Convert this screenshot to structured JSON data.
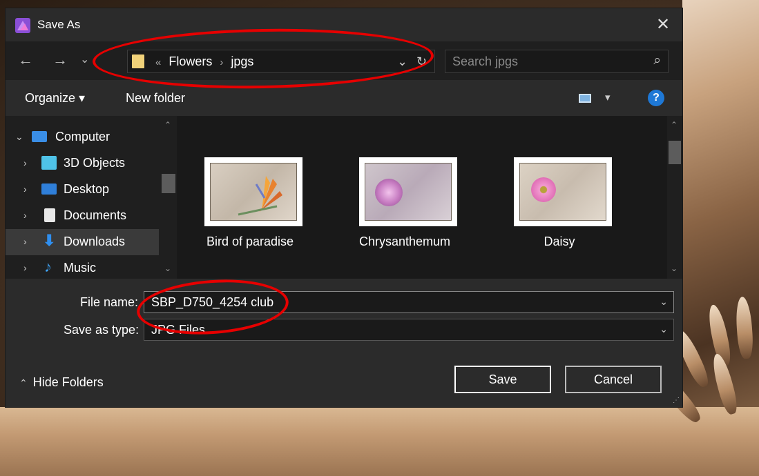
{
  "window": {
    "title": "Save As",
    "close_glyph": "✕"
  },
  "nav": {
    "back": "←",
    "forward": "→",
    "recent": "⌄",
    "breadcrumb": {
      "overflow": "«",
      "items": [
        "Flowers",
        "jpgs"
      ],
      "separator": "›"
    },
    "dropdown": "⌄",
    "refresh": "↻",
    "search_placeholder": "Search jpgs",
    "search_glyph": "⌕"
  },
  "toolbar": {
    "organize": "Organize ▾",
    "new_folder": "New folder",
    "help": "?"
  },
  "sidebar": {
    "items": [
      {
        "label": "Computer",
        "icon": "computer-icon",
        "chevron": "⌄",
        "color": "#3a8ee6"
      },
      {
        "label": "3D Objects",
        "icon": "3d-objects-icon",
        "chevron": "›",
        "color": "#4fc3e8"
      },
      {
        "label": "Desktop",
        "icon": "desktop-icon",
        "chevron": "›",
        "color": "#2f7fd9"
      },
      {
        "label": "Documents",
        "icon": "documents-icon",
        "chevron": "›",
        "color": "#e8e8e8"
      },
      {
        "label": "Downloads",
        "icon": "downloads-icon",
        "chevron": "›",
        "color": "#2f8ff0"
      },
      {
        "label": "Music",
        "icon": "music-icon",
        "chevron": "›",
        "color": "#3ea3f5"
      }
    ]
  },
  "files": [
    {
      "name": "Bird of paradise"
    },
    {
      "name": "Chrysanthemum"
    },
    {
      "name": "Daisy"
    }
  ],
  "form": {
    "file_name_label": "File name:",
    "file_name_value": "SBP_D750_4254 club",
    "save_type_label": "Save as type:",
    "save_type_value": "JPG Files",
    "dropdown_glyph": "⌄",
    "hide_folders": "Hide Folders",
    "save": "Save",
    "cancel": "Cancel"
  },
  "colors": {
    "annotation": "#e60000",
    "dialog_bg": "#2b2b2b",
    "accent": "#1e78d6"
  }
}
